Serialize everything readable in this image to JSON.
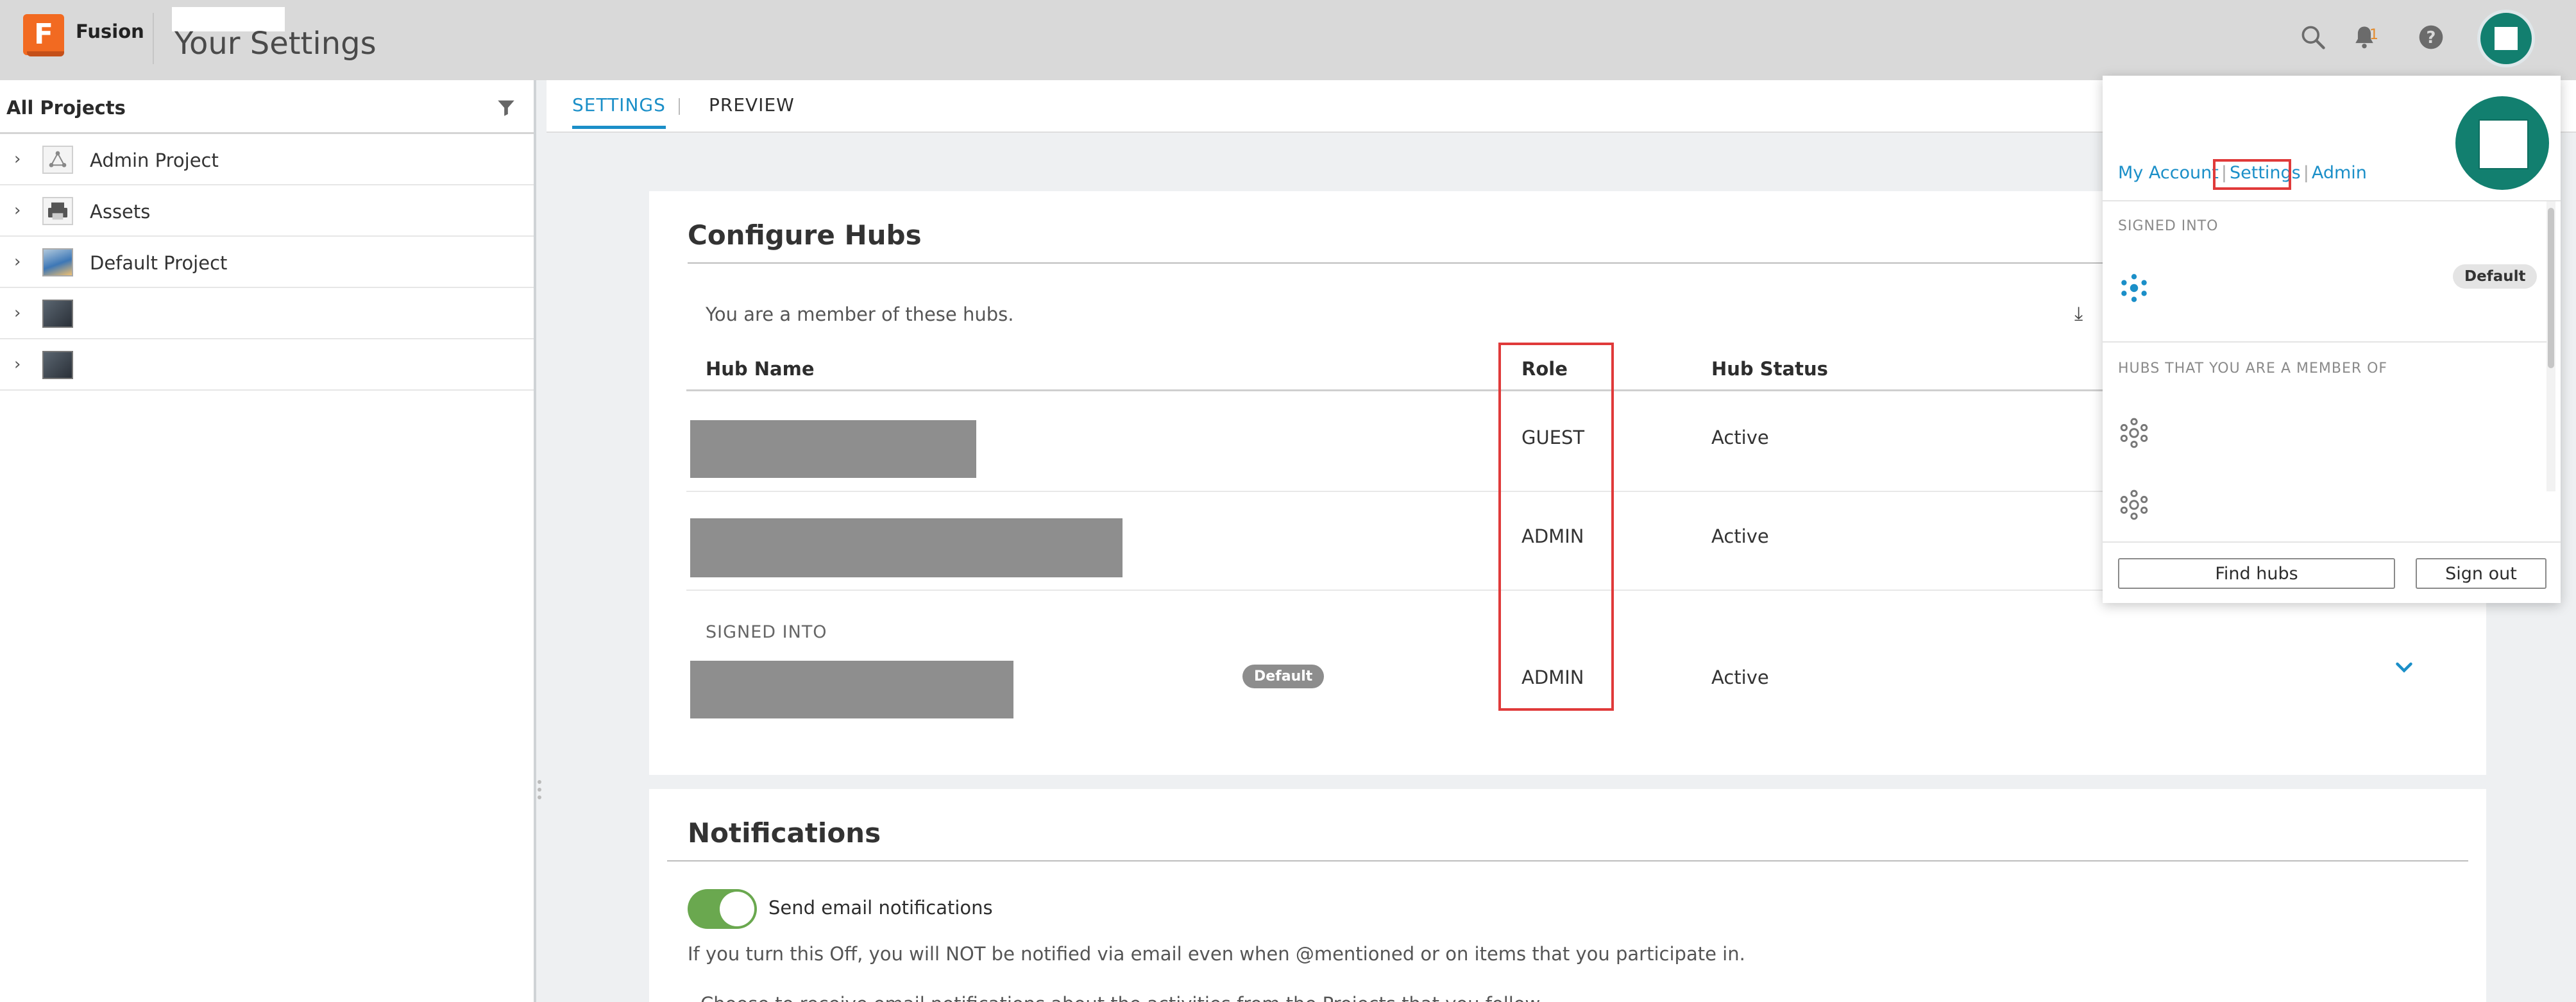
{
  "header": {
    "app_name": "Fusion",
    "logo_letter": "F",
    "page_title": "Your Settings",
    "notification_count": "1",
    "icons": [
      "search-icon",
      "bell-icon",
      "help-icon"
    ]
  },
  "left_panel": {
    "title": "All Projects",
    "projects": [
      {
        "name": "Admin Project",
        "thumb": "network-icon"
      },
      {
        "name": "Assets",
        "thumb": "printer-icon"
      },
      {
        "name": "Default Project",
        "thumb": "image-thumbnail"
      },
      {
        "name": "",
        "thumb": "dark-thumbnail"
      },
      {
        "name": "",
        "thumb": "dark-thumbnail"
      }
    ]
  },
  "tabs": [
    {
      "label": "SETTINGS",
      "active": true
    },
    {
      "label": "PREVIEW",
      "active": false
    }
  ],
  "configure_hubs": {
    "title": "Configure Hubs",
    "intro": "You are a member of these hubs.",
    "columns": [
      "Hub Name",
      "Role",
      "Hub Status"
    ],
    "rows": [
      {
        "role": "GUEST",
        "status": "Active"
      },
      {
        "role": "ADMIN",
        "status": "Active"
      },
      {
        "role": "ADMIN",
        "status": "Active",
        "signed_into": "SIGNED INTO",
        "badge": "Default"
      }
    ]
  },
  "notifications": {
    "title": "Notifications",
    "toggle_label": "Send email notifications",
    "toggle_on": true,
    "description": "If you turn this Off, you will NOT be notified via email even when @mentioned or on items that you participate in.",
    "cut_line": "Choose to receive email notifications about the activities from the Projects that you follow"
  },
  "account_menu": {
    "links": [
      "My Account",
      "Settings",
      "Admin"
    ],
    "signed_into_label": "SIGNED INTO",
    "default_badge": "Default",
    "member_label": "HUBS THAT YOU ARE A MEMBER OF",
    "find_hubs": "Find hubs",
    "sign_out": "Sign out"
  },
  "colors": {
    "accent": "#1b8fc8",
    "avatar": "#127f6f",
    "highlight": "#e03a3a",
    "toggle_on": "#6aa84f",
    "logo": "#f26a21"
  }
}
